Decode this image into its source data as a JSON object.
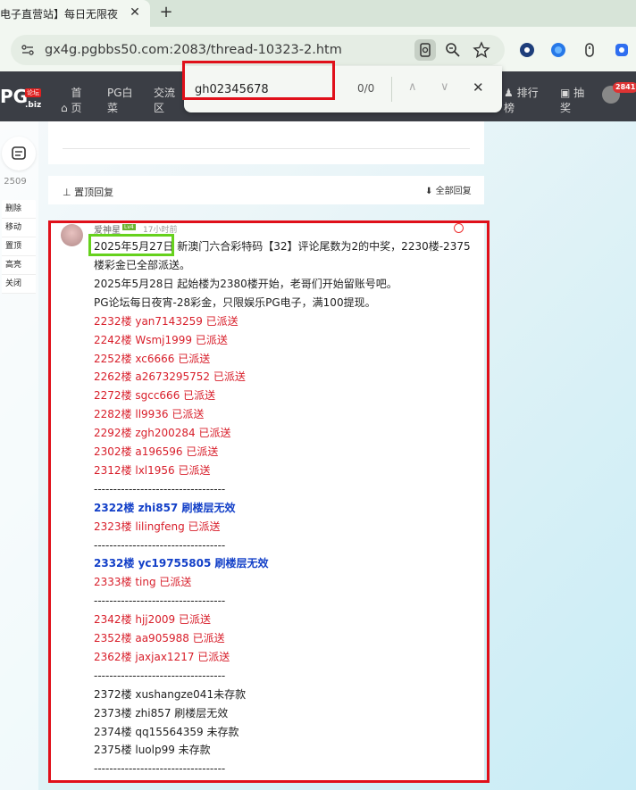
{
  "browser": {
    "tab_title": "电子直营站】每日无限夜",
    "tab_close": "✕",
    "new_tab": "+",
    "url": "gx4g.pgbbs50.com:2083/thread-10323-2.htm"
  },
  "find_bar": {
    "query": "gh02345678",
    "count": "0/0",
    "up": "∧",
    "down": "∨",
    "close": "✕"
  },
  "header": {
    "logo": "PG",
    "logo_badge": "论坛",
    "logo_domain": ".biz",
    "nav": [
      {
        "label": "首页"
      },
      {
        "label": "PG白菜"
      },
      {
        "label": "交流区"
      },
      {
        "label": "排行榜"
      },
      {
        "label": "抽奖"
      }
    ],
    "notification_count": "2841"
  },
  "left_rail": {
    "count": "2509",
    "menu": [
      "删除",
      "移动",
      "置顶",
      "高亮",
      "关闭"
    ]
  },
  "reply_bar": {
    "title": "置顶回复",
    "all_replies": "全部回复"
  },
  "post": {
    "author": "爱神星",
    "level": "Lv4",
    "time": "17小时前",
    "date_highlight": "2025年5月27日",
    "first_line_rest": "新澳门六合彩特码【32】评论尾数为2的中奖，2230楼-2375",
    "lines": [
      {
        "text": "楼彩金已全部派送。",
        "style": "black"
      },
      {
        "text": "2025年5月28日 起始楼为2380楼开始，老哥们开始留账号吧。",
        "style": "black"
      },
      {
        "text": "PG论坛每日夜宵-28彩金，只限娱乐PG电子，满100提现。",
        "style": "black"
      },
      {
        "text": "2232楼 yan7143259 已派送",
        "style": "red"
      },
      {
        "text": "2242楼 Wsmj1999 已派送",
        "style": "red"
      },
      {
        "text": "2252楼 xc6666 已派送",
        "style": "red"
      },
      {
        "text": "2262楼 a2673295752 已派送",
        "style": "red"
      },
      {
        "text": "2272楼 sgcc666 已派送",
        "style": "red"
      },
      {
        "text": "2282楼 ll9936 已派送",
        "style": "red"
      },
      {
        "text": "2292楼 zgh200284 已派送",
        "style": "red"
      },
      {
        "text": "2302楼 a196596 已派送",
        "style": "red"
      },
      {
        "text": "2312楼 lxl1956 已派送",
        "style": "red"
      },
      {
        "text": "----------------------------------",
        "style": "black"
      },
      {
        "text": "2322楼 zhi857 刷楼层无效",
        "style": "blue"
      },
      {
        "text": "2323楼 lilingfeng 已派送",
        "style": "red"
      },
      {
        "text": "----------------------------------",
        "style": "black"
      },
      {
        "text": "2332楼 yc19755805 刷楼层无效",
        "style": "blue"
      },
      {
        "text": "2333楼 ting 已派送",
        "style": "red"
      },
      {
        "text": "----------------------------------",
        "style": "black"
      },
      {
        "text": "2342楼 hjj2009 已派送",
        "style": "red"
      },
      {
        "text": "2352楼 aa905988 已派送",
        "style": "red"
      },
      {
        "text": "2362楼 jaxjax1217 已派送",
        "style": "red"
      },
      {
        "text": "----------------------------------",
        "style": "black"
      },
      {
        "text": "2372楼 xushangze041未存款",
        "style": "black"
      },
      {
        "text": "2373楼 zhi857 刷楼层无效",
        "style": "black"
      },
      {
        "text": "2374楼 qq15564359 未存款",
        "style": "black"
      },
      {
        "text": "2375楼 luolp99 未存款",
        "style": "black"
      },
      {
        "text": "----------------------------------",
        "style": "black"
      }
    ]
  },
  "colors": {
    "red_text": "#d81e2a",
    "blue_text": "#1340c8",
    "highlight_red": "#e0101a",
    "highlight_green": "#66d11d",
    "header_bg": "#3b3e45"
  }
}
